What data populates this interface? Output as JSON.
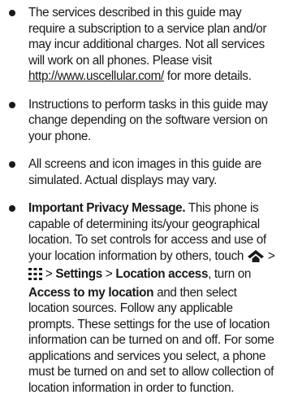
{
  "bullets": [
    {
      "text_before_link": "The services described in this guide may require a subscription to a service plan and/or may incur additional charges. Not all services will work on all phones. Please visit ",
      "link": "http://www.uscellular.com/",
      "text_after_link": " for more details."
    },
    {
      "text": "Instructions to perform tasks in this guide may change depending on the software version on your phone."
    },
    {
      "text": "All screens and icon images in this guide are simulated. Actual displays may vary."
    },
    {
      "title": "Important Privacy Message.",
      "intro": " This phone is capable of determining its/your geographical location. To set controls for access and use of your location information by others, touch ",
      "sep1": " > ",
      "sep2": " > ",
      "settings": "Settings",
      "sep3": " > ",
      "location_access": "Location access",
      "turn_on": ", turn on ",
      "access_to_my_location": "Access to my location",
      "rest": " and then select location sources. Follow any applicable prompts. These settings for the use of location information can be turned on and off. For some applications and services you select, a phone must be turned on and set to allow collection of location information in order to function.",
      "icons": [
        "home-icon",
        "apps-grid-icon"
      ]
    }
  ]
}
